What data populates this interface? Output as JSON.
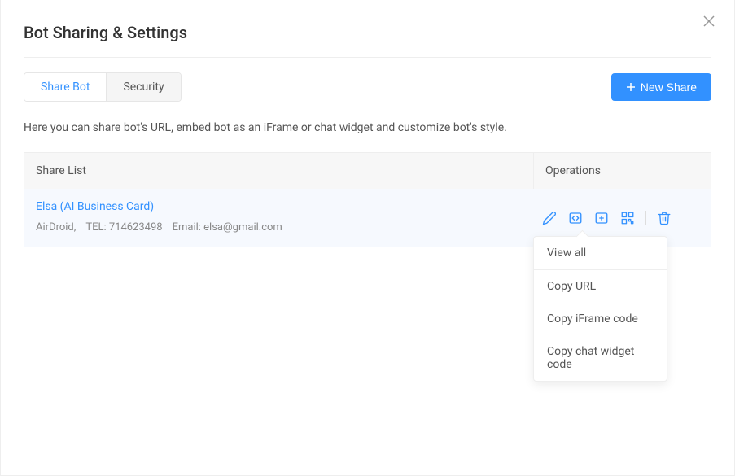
{
  "modal": {
    "title": "Bot Sharing & Settings"
  },
  "tabs": {
    "share": "Share Bot",
    "security": "Security"
  },
  "buttons": {
    "new_share": "New Share"
  },
  "description": "Here you can share bot's URL, embed bot as an iFrame or chat widget and customize bot's style.",
  "table": {
    "col_share_list": "Share List",
    "col_operations": "Operations"
  },
  "row": {
    "title": "Elsa (AI Business Card)",
    "org": "AirDroid,",
    "tel": "TEL: 714623498",
    "email": "Email: elsa@gmail.com"
  },
  "popover": {
    "view_all": "View all",
    "copy_url": "Copy URL",
    "copy_iframe": "Copy iFrame code",
    "copy_widget": "Copy chat widget code"
  }
}
